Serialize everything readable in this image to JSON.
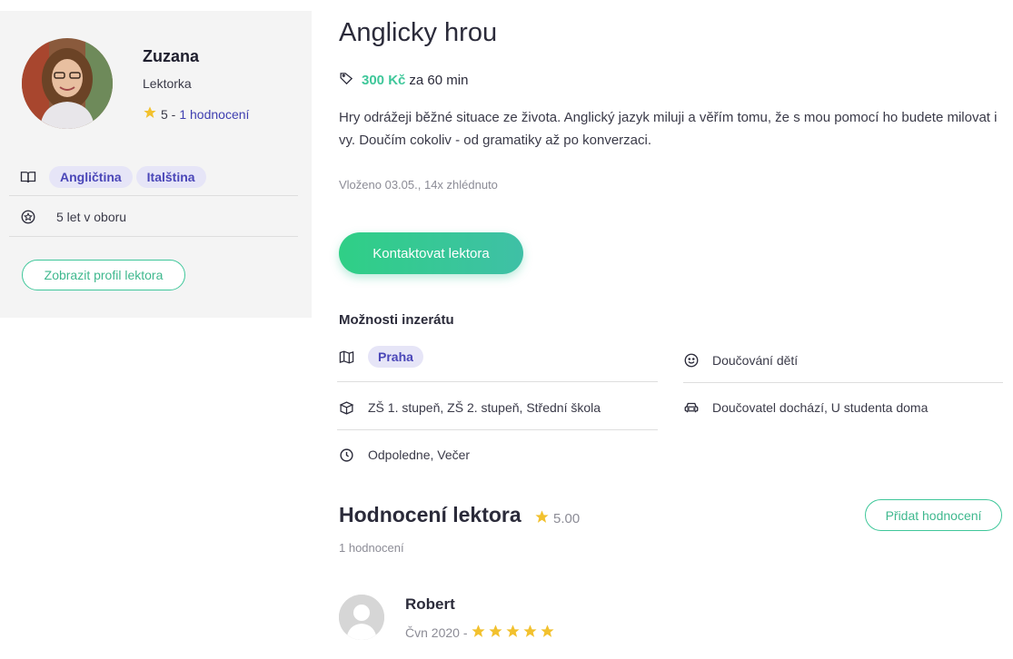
{
  "tutor": {
    "name": "Zuzana",
    "role": "Lektorka",
    "rating_value": "5 -",
    "rating_link": "1 hodnocení",
    "languages": [
      "Angličtina",
      "Italština"
    ],
    "experience": "5 let v oboru",
    "profile_button": "Zobrazit profil lektora"
  },
  "listing": {
    "title": "Anglicky hrou",
    "price": "300 Kč",
    "price_suffix": "za 60 min",
    "description": "Hry odrážeji běžné situace ze života. Anglický jazyk miluji a věřím tomu, že s mou pomocí ho budete milovat i vy. Doučím cokoliv - od gramatiky až po konverzaci.",
    "meta": "Vloženo 03.05., 14x zhlédnuto",
    "contact_button": "Kontaktovat lektora"
  },
  "options": {
    "title": "Možnosti inzerátu",
    "location": "Praha",
    "children": "Doučování dětí",
    "levels": "ZŠ 1. stupeň, ZŠ 2. stupeň, Střední škola",
    "place": "Doučovatel dochází, U studenta doma",
    "time": "Odpoledne, Večer"
  },
  "reviews": {
    "title": "Hodnocení lektora",
    "score": "5.00",
    "count": "1 hodnocení",
    "add_button": "Přidat hodnocení",
    "items": [
      {
        "name": "Robert",
        "date": "Čvn 2020 -",
        "stars": 5
      }
    ]
  },
  "colors": {
    "accent": "#3fc79a",
    "tag_bg": "#e6e5f7",
    "tag_text": "#4a46b8",
    "star": "#f2c12e"
  }
}
